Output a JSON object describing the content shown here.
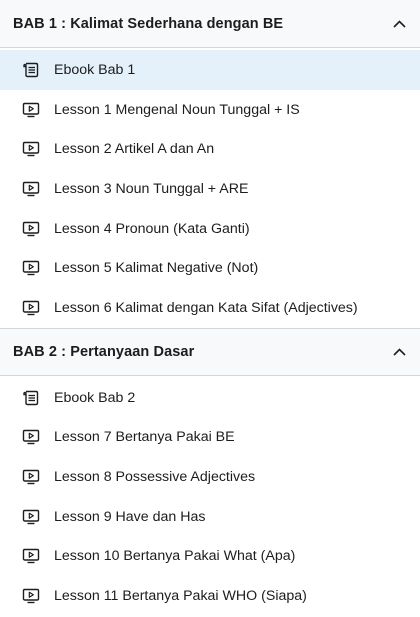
{
  "sections": [
    {
      "title": "BAB 1 : Kalimat Sederhana dengan BE",
      "expanded": true,
      "items": [
        {
          "label": "Ebook Bab 1",
          "icon": "ebook-icon",
          "active": true
        },
        {
          "label": "Lesson 1 Mengenal Noun Tunggal + IS",
          "icon": "video-icon"
        },
        {
          "label": "Lesson 2 Artikel A dan An",
          "icon": "video-icon"
        },
        {
          "label": "Lesson 3 Noun Tunggal + ARE",
          "icon": "video-icon"
        },
        {
          "label": "Lesson 4 Pronoun (Kata Ganti)",
          "icon": "video-icon"
        },
        {
          "label": "Lesson 5 Kalimat Negative (Not)",
          "icon": "video-icon"
        },
        {
          "label": "Lesson 6 Kalimat dengan Kata Sifat (Adjectives)",
          "icon": "video-icon"
        }
      ]
    },
    {
      "title": "BAB 2 : Pertanyaan Dasar",
      "expanded": true,
      "items": [
        {
          "label": "Ebook Bab 2",
          "icon": "ebook-icon"
        },
        {
          "label": "Lesson 7 Bertanya Pakai BE",
          "icon": "video-icon"
        },
        {
          "label": "Lesson 8 Possessive Adjectives",
          "icon": "video-icon"
        },
        {
          "label": "Lesson 9 Have dan Has",
          "icon": "video-icon"
        },
        {
          "label": "Lesson 10 Bertanya Pakai What (Apa)",
          "icon": "video-icon"
        },
        {
          "label": "Lesson 11 Bertanya Pakai WHO (Siapa)",
          "icon": "video-icon"
        }
      ]
    }
  ],
  "colors": {
    "header_bg": "#f7f9fa",
    "active_bg": "#e4f1fb",
    "border": "#d1d7dc",
    "text": "#1c1d1f"
  }
}
